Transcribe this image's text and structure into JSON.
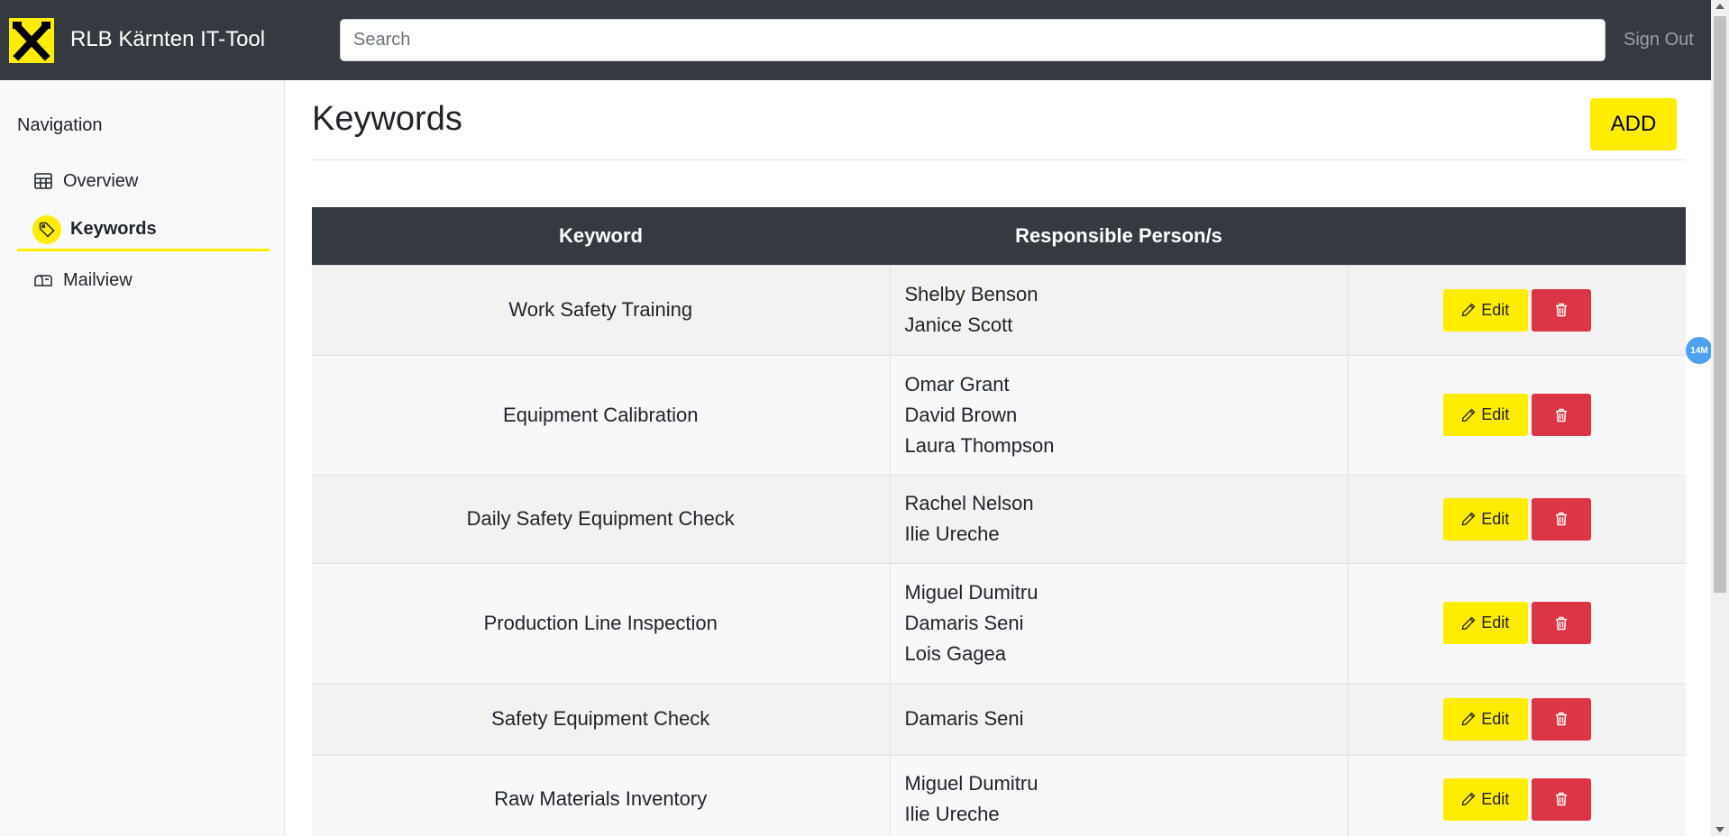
{
  "header": {
    "app_title": "RLB Kärnten IT-Tool",
    "search_placeholder": "Search",
    "signout_label": "Sign Out",
    "logo_icon": "raiffeisen-crossed-horses-logo",
    "accent_color": "#ffed00",
    "bar_color": "#343a40"
  },
  "sidebar": {
    "heading": "Navigation",
    "items": [
      {
        "label": "Overview",
        "icon": "table-icon",
        "active": false
      },
      {
        "label": "Keywords",
        "icon": "tag-icon",
        "active": true
      },
      {
        "label": "Mailview",
        "icon": "mailbox-icon",
        "active": false
      }
    ]
  },
  "main": {
    "title": "Keywords",
    "add_label": "ADD",
    "table": {
      "columns": [
        "Keyword",
        "Responsible Person/s",
        ""
      ],
      "rows": [
        {
          "keyword": "Work Safety Training",
          "persons": [
            "Shelby Benson",
            "Janice Scott"
          ]
        },
        {
          "keyword": "Equipment Calibration",
          "persons": [
            "Omar Grant",
            "David Brown",
            "Laura Thompson"
          ]
        },
        {
          "keyword": "Daily Safety Equipment Check",
          "persons": [
            "Rachel Nelson",
            "Ilie Ureche"
          ]
        },
        {
          "keyword": "Production Line Inspection",
          "persons": [
            "Miguel Dumitru",
            "Damaris Seni",
            "Lois Gagea"
          ]
        },
        {
          "keyword": "Safety Equipment Check",
          "persons": [
            "Damaris Seni"
          ]
        },
        {
          "keyword": "Raw Materials Inventory",
          "persons": [
            "Miguel Dumitru",
            "Ilie Ureche"
          ]
        }
      ],
      "edit_label": "Edit",
      "delete_icon": "trash-icon",
      "delete_color": "#dc3545"
    }
  },
  "extension_badge": "14M"
}
